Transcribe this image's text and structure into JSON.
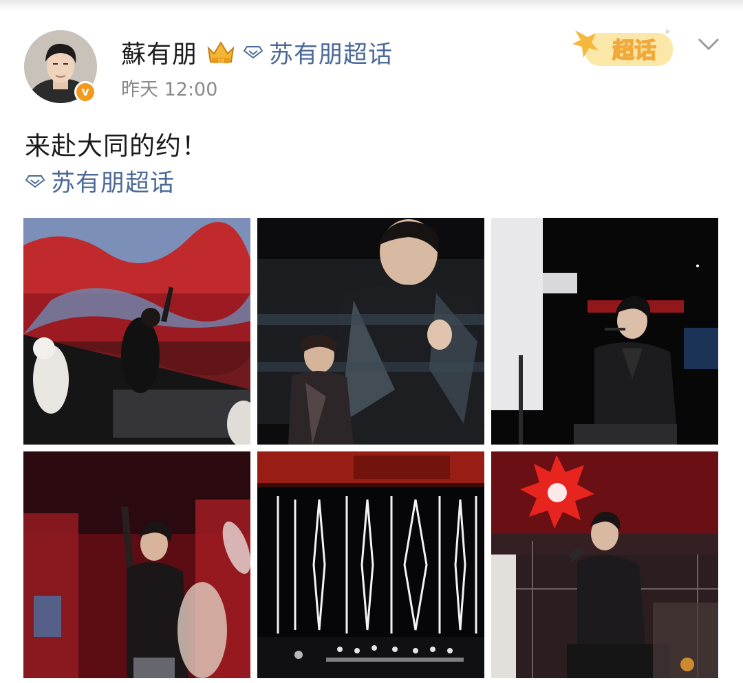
{
  "post": {
    "username": "蘇有朋",
    "topic_label": "苏有朋超话",
    "timestamp": "昨天 12:00",
    "verified_mark": "v",
    "badge_label": "超话",
    "text": "来赴大同的约！",
    "topic_link": "苏有朋超话"
  },
  "colors": {
    "link": "#4b6a97",
    "badge_orange": "#f39a1e",
    "stage_red": "#b3121c"
  },
  "photos": [
    {
      "name": "photo-1",
      "caption": ""
    },
    {
      "name": "photo-2",
      "caption": ""
    },
    {
      "name": "photo-3",
      "caption": ""
    },
    {
      "name": "photo-4",
      "caption": ""
    },
    {
      "name": "photo-5",
      "caption": ""
    },
    {
      "name": "photo-6",
      "caption": ""
    }
  ]
}
